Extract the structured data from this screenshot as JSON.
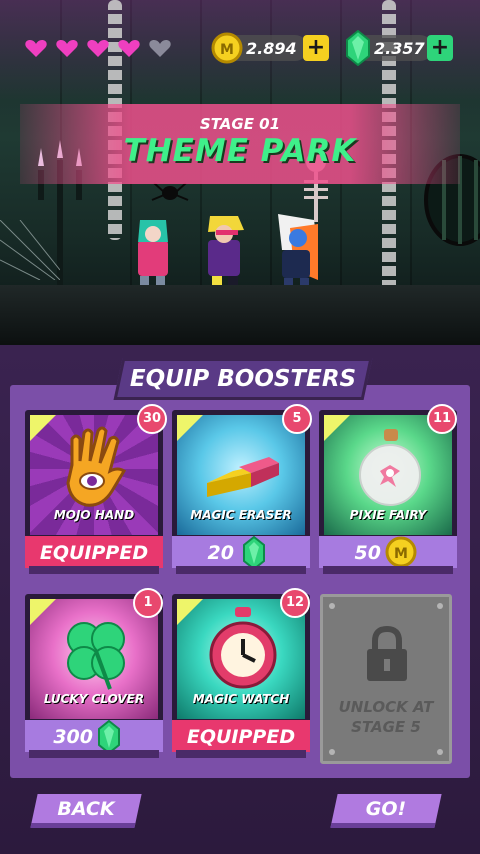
{
  "hud": {
    "hearts": {
      "filled": 4,
      "total": 5,
      "filled_color": "#ef3fc0",
      "empty_color": "#8a8a9a"
    },
    "coins": "2.894",
    "gems": "2.357",
    "coin_plus": "+",
    "gem_plus": "+"
  },
  "stage": {
    "label": "STAGE 01",
    "name": "THEME PARK"
  },
  "equip": {
    "title": "EQUIP BOOSTERS",
    "cards": [
      {
        "name": "MOJO HAND",
        "count": "30",
        "status": "EQUIPPED",
        "icon": "mojo-hand-icon"
      },
      {
        "name": "MAGIC ERASER",
        "count": "5",
        "price": "20",
        "currency": "gem",
        "icon": "eraser-icon"
      },
      {
        "name": "PIXIE FAIRY",
        "count": "11",
        "price": "50",
        "currency": "coin",
        "icon": "fairy-jar-icon"
      },
      {
        "name": "LUCKY CLOVER",
        "count": "1",
        "price": "300",
        "currency": "gem",
        "icon": "clover-icon"
      },
      {
        "name": "MAGIC WATCH",
        "count": "12",
        "status": "EQUIPPED",
        "icon": "stopwatch-icon"
      }
    ],
    "locked": {
      "text": "UNLOCK AT\nSTAGE 5",
      "icon": "padlock-icon"
    }
  },
  "nav": {
    "back": "BACK",
    "go": "GO!"
  },
  "colors": {
    "equipped_bar": "#e8386e",
    "price_bar": "#a77be0",
    "stage_name": "#3ff08a",
    "banner": "#ee508c"
  }
}
